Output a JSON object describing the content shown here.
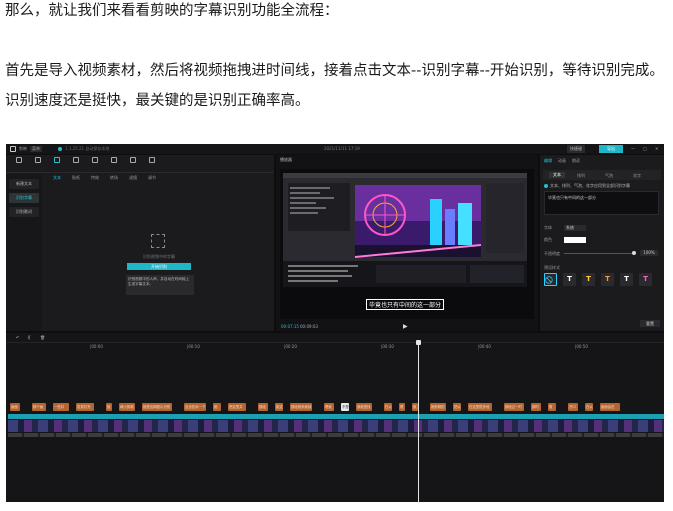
{
  "article": {
    "p1": "那么，就让我们来看看剪映的字幕识别功能全流程：",
    "p2": "首先是导入视频素材，然后将视频拖拽进时间线，接着点击文本--识别字幕--开始识别，等待识别完成。识别速度还是挺快，最关键的是识别正确率高。"
  },
  "editor": {
    "titlebar": {
      "app": "剪映",
      "menu": "菜单",
      "project": "1.1.25.21 自动保存本地",
      "center": "2021/11/11 17:19",
      "shortcut": "快捷键",
      "export": "导出",
      "win_min": "—",
      "win_max": "□",
      "win_close": "✕"
    },
    "top_tabs": [
      "视频",
      "音频",
      "文本",
      "贴纸",
      "特效",
      "转场",
      "滤镜",
      "调节"
    ],
    "active_tab": "文本",
    "sidebar": [
      "新建文本",
      "识别字幕",
      "识别歌词"
    ],
    "sidebar_active": "识别字幕",
    "media": {
      "hint": "识别视频中的字幕",
      "start": "开始识别",
      "tip": "识别视频中的人声，并自动在时间轴上生成字幕文本。"
    },
    "player": {
      "header": "播放器",
      "subtitle": "毕竟也只有中间的这一部分",
      "time_current": "00:07:15",
      "time_total": "00:09:03",
      "play": "▶"
    },
    "right_panel": {
      "tabs": [
        "编辑",
        "动画",
        "朗读"
      ],
      "subtabs": [
        "文本",
        "排列",
        "气泡",
        "花字"
      ],
      "checkbox_label": "文本、排列、气泡、花字应用到全部识别字幕",
      "text_value": "毕竟也只有中间的这一部分",
      "font_label": "字体",
      "font_value": "系统",
      "color_label": "颜色",
      "opacity_label": "不透明度",
      "opacity_value": "100%",
      "preset_label": "预设样式",
      "swatches": [
        "⃠",
        "T",
        "T",
        "T",
        "T",
        "T"
      ],
      "reset": "重置"
    },
    "timeline": {
      "tools": [
        "↶",
        "I[",
        "🗑"
      ],
      "ticks": [
        "|00:00",
        "|00:10",
        "|00:20",
        "|00:30",
        "|00:40",
        "|00:50"
      ],
      "subtitles": [
        "画面",
        "那个画",
        "一些并",
        "发现并完",
        "就",
        "两小剪辑",
        "就是这种图片识别",
        "这也告诉一下",
        "她",
        "把这里并",
        "那段",
        "能这",
        "那段用来继续",
        "嗯就",
        "不是",
        "我就是找",
        "在以",
        "嗯",
        "就",
        "她剪辑的",
        "把以",
        "在这里很多他",
        "那段过一时",
        "即时",
        "照",
        "开口",
        "在以",
        "画面会在"
      ]
    }
  }
}
